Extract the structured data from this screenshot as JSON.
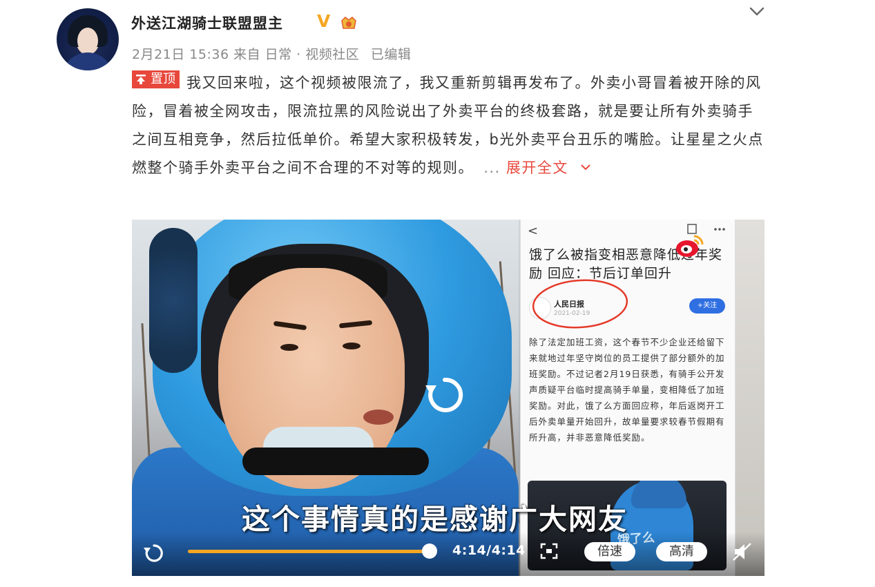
{
  "post": {
    "author": {
      "name": "外送江湖骑士联盟盟主",
      "verified_mark": "V"
    },
    "meta": {
      "date": "2月21日 15:36",
      "source": "来自 日常 · 视频社区",
      "edited": "已编辑"
    },
    "pin_label": "置顶",
    "content": "我又回来啦，这个视频被限流了，我又重新剪辑再发布了。外卖小哥冒着被开除的风险，冒着被全网攻击，限流拉黑的风险说出了外卖平台的终极套路，就是要让所有外卖骑手之间互相竞争，然后拉低单价。希望大家积极转发，b光外卖平台丑乐的嘴脸。让星星之火点燃整个骑手外卖平台之间不合理的不对等的规则。",
    "ellipsis": "...",
    "expand_label": "展开全文"
  },
  "video": {
    "subtitle": "这个事情真的是感谢广大网友",
    "time": "4:14/4:14",
    "progress": 1.0,
    "speed_label": "倍速",
    "quality_label": "高清",
    "overlay_article": {
      "back": "<",
      "title": "饿了么被指变相恶意降低过年奖励 回应：节后订单回升",
      "author": "人民日报",
      "date": "2021-02-19",
      "follow": "+关注",
      "body": "除了法定加班工资，这个春节不少企业还给留下来就地过年坚守岗位的员工提供了部分额外的加班奖励。不过记者2月19日获悉，有骑手公开发声质疑平台临时提高骑手单量，变相降低了加班奖励。对此，饿了么方面回应称，年后返岗开工后外卖单量开始回升，故单量要求较春节假期有所升高，并非恶意降低奖励。",
      "thumb_brand": "饿了么"
    }
  },
  "colors": {
    "accent": "#e8473c",
    "progress": "#f5a623",
    "vip": "#f5a623"
  },
  "icons": [
    "chevron-down-icon",
    "pin-icon",
    "replay-icon",
    "fullscreen-icon",
    "mute-icon",
    "weibo-logo-icon"
  ]
}
